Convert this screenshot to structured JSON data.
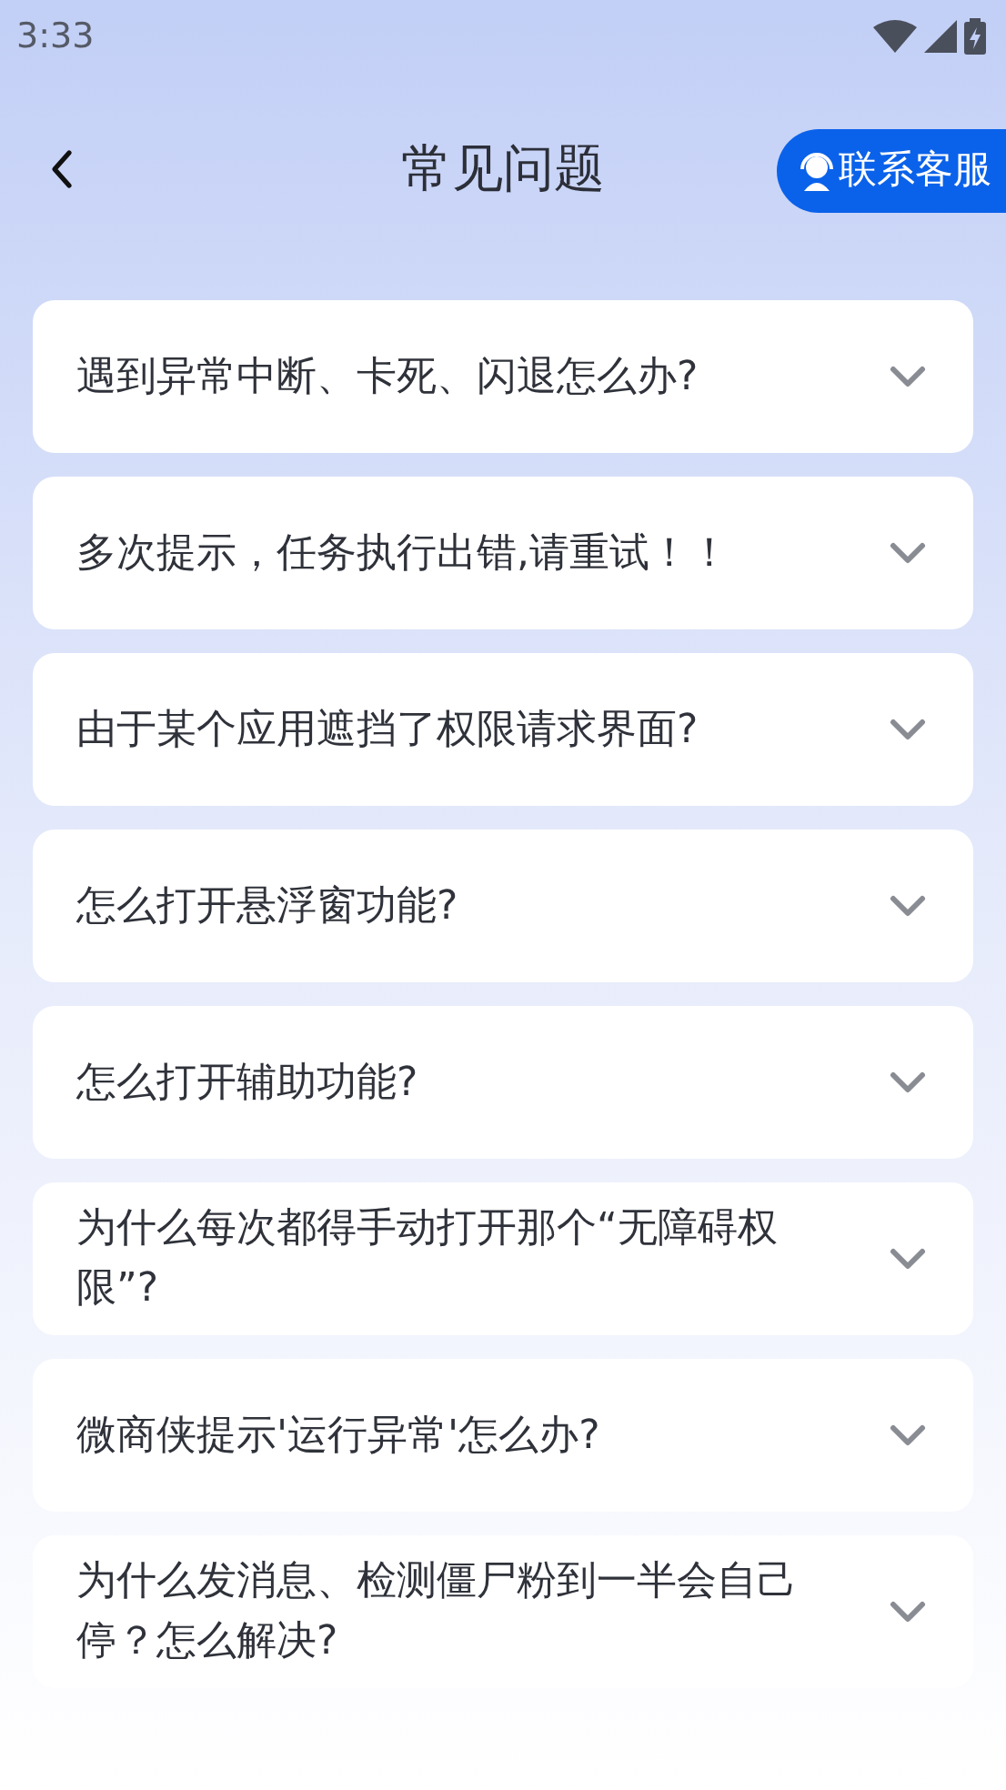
{
  "status_bar": {
    "time": "3:33"
  },
  "header": {
    "title": "常见问题",
    "contact_button": "联系客服"
  },
  "faq": [
    {
      "question": "遇到异常中断、卡死、闪退怎么办?",
      "expanded": false
    },
    {
      "question": "多次提示，任务执行出错,请重试！！",
      "expanded": false
    },
    {
      "question": "由于某个应用遮挡了权限请求界面?",
      "expanded": false
    },
    {
      "question": "怎么打开悬浮窗功能?",
      "expanded": false
    },
    {
      "question": "怎么打开辅助功能?",
      "expanded": false
    },
    {
      "question": "为什么每次都得手动打开那个“无障碍权限”?",
      "expanded": false
    },
    {
      "question": "微商侠提示'运行异常'怎么办?",
      "expanded": false
    },
    {
      "question": "为什么发消息、检测僵尸粉到一半会自己停？怎么解决?",
      "expanded": false
    }
  ]
}
